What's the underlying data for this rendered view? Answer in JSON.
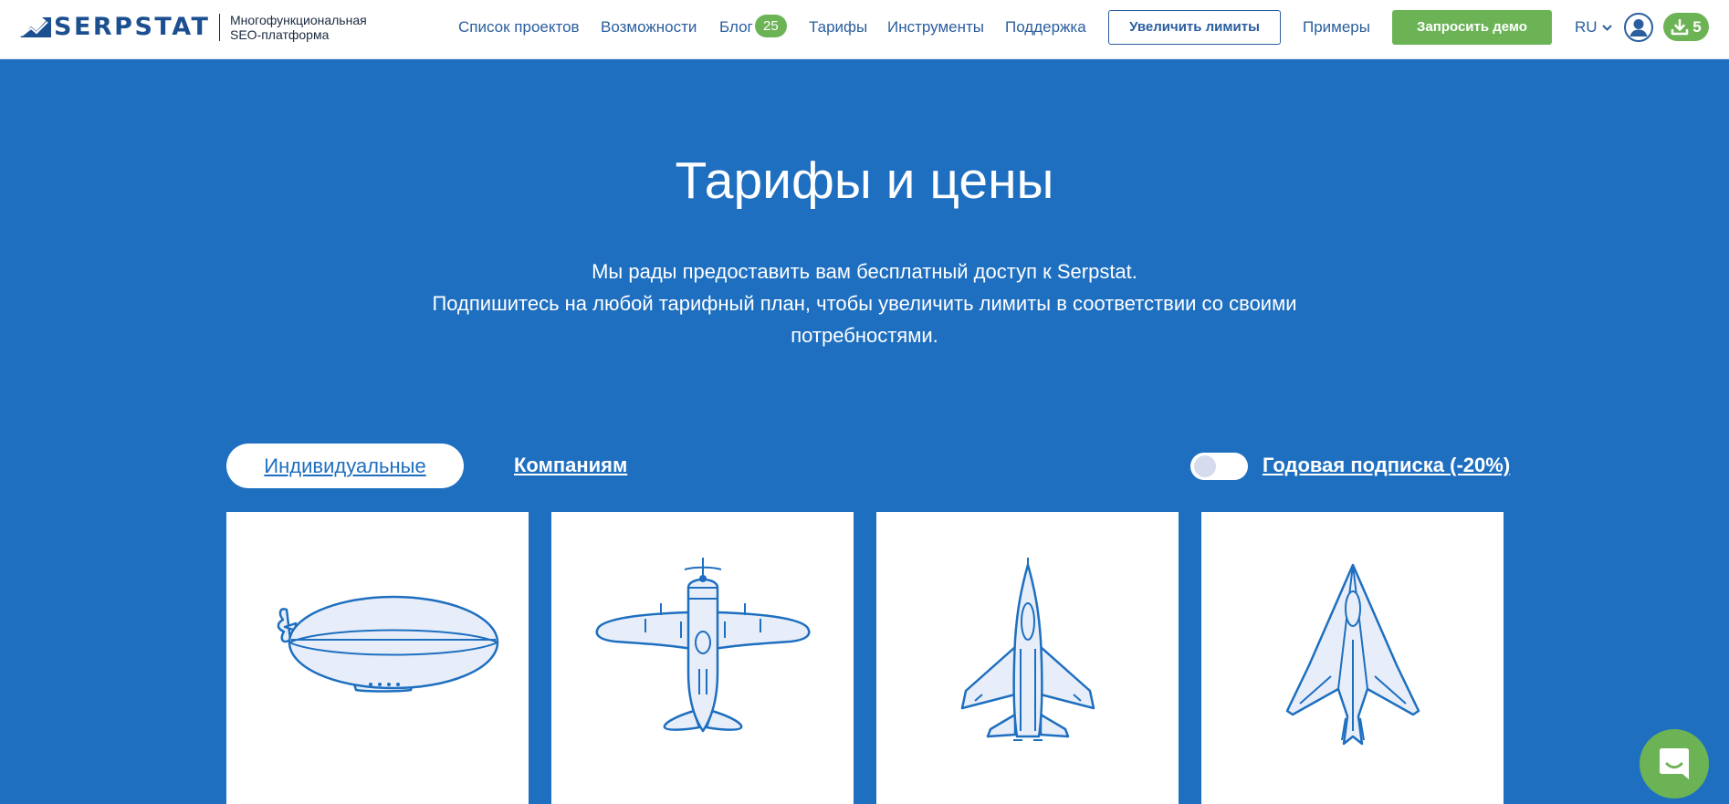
{
  "header": {
    "logo_text": "SERPSTAT",
    "tagline_line1": "Многофункциональная",
    "tagline_line2": "SEO-платформа",
    "nav": {
      "projects": "Список проектов",
      "features": "Возможности",
      "blog": "Блог",
      "blog_badge": "25",
      "pricing": "Тарифы",
      "tools": "Инструменты",
      "support": "Поддержка"
    },
    "increase_limits": "Увеличить лимиты",
    "examples": "Примеры",
    "request_demo": "Запросить демо",
    "language": "RU",
    "downloads_count": "5"
  },
  "hero": {
    "title": "Тарифы и цены",
    "subtitle_line1": "Мы рады предоставить вам бесплатный доступ к Serpstat.",
    "subtitle_line2": "Подпишитесь на любой тарифный план, чтобы увеличить лимиты в соответствии со своими",
    "subtitle_line3": "потребностями."
  },
  "tabs": {
    "individual": "Индивидуальные",
    "companies": "Компаниям"
  },
  "annual_toggle": {
    "label": "Годовая подписка (-20%)",
    "enabled": false
  },
  "plans": [
    {
      "icon": "airship-icon"
    },
    {
      "icon": "propeller-plane-icon"
    },
    {
      "icon": "fighter-jet-icon"
    },
    {
      "icon": "stealth-jet-icon"
    }
  ],
  "colors": {
    "brand_blue": "#1e6fc0",
    "nav_text": "#2b5e9e",
    "accent_green": "#6cb356",
    "icon_stroke": "#1e6fc0",
    "icon_fill": "#e8eef9"
  }
}
